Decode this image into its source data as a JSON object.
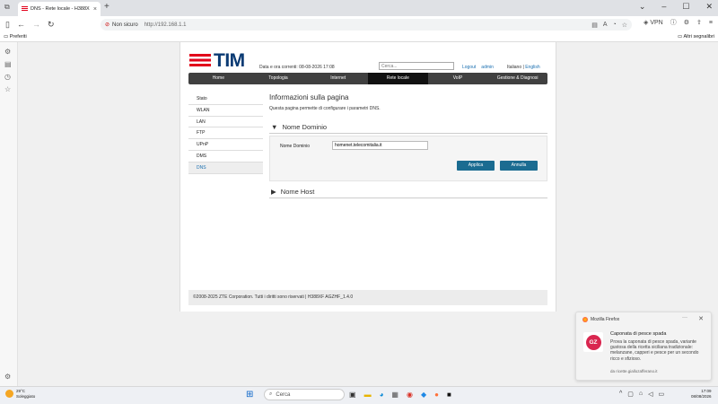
{
  "browser": {
    "tab_title": "DNS - Rete locale - H388X",
    "address_security": "Non sicuro",
    "address_url": "http://192.168.1.1",
    "vpn_label": "VPN",
    "bookmarks_left": "Preferiti",
    "bookmarks_right": "Altri segnalibri"
  },
  "router": {
    "logo_text": "TIM",
    "datetime_label": "Data e ora correnti: 08-08-2026 17:08",
    "search_placeholder": "Cerca...",
    "logout_label": "Logout",
    "user_label": "admin",
    "lang_it": "Italiano",
    "lang_sep": "|",
    "lang_en": "English",
    "nav": [
      {
        "label": "Home"
      },
      {
        "label": "Topologia"
      },
      {
        "label": "Internet"
      },
      {
        "label": "Rete locale",
        "active": true
      },
      {
        "label": "VoIP"
      },
      {
        "label": "Gestione & Diagnosi"
      }
    ],
    "side_menu": [
      {
        "label": "Stato"
      },
      {
        "label": "WLAN"
      },
      {
        "label": "LAN"
      },
      {
        "label": "FTP"
      },
      {
        "label": "UPnP"
      },
      {
        "label": "DMS"
      },
      {
        "label": "DNS",
        "selected": true
      }
    ],
    "page_title": "Informazioni sulla pagina",
    "page_description": "Questa pagina permette di configurare i parametri DNS.",
    "section_domain": "Nome Dominio",
    "domain_field_label": "Nome Dominio",
    "domain_field_value": "homenet.telecomitalia.it",
    "apply_label": "Applica",
    "cancel_label": "Annulla",
    "section_host": "Nome Host",
    "footer": "©2008-2025 ZTE Corporation. Tutti i diritti sono riservati  |  H388XF AGZHF_1.4.0"
  },
  "notification": {
    "app": "Mozilla Firefox",
    "title": "Caponata di pesce spada",
    "body": "Prova la caponata di pesce spada, variante gustosa della ricetta siciliana tradizionale: melanzane, capperi e pesce per un secondo ricco e sfizioso.",
    "source": "da ricette.giallozafferano.it",
    "icon_text": "GZ"
  },
  "taskbar": {
    "temp": "29°C",
    "weather": "Soleggiato",
    "search_label": "Cerca",
    "time": "17:09",
    "date": "08/08/2026"
  },
  "colors": {
    "tim_red": "#e2001a",
    "tim_blue": "#0a3a73",
    "button_blue": "#1b6c91"
  }
}
